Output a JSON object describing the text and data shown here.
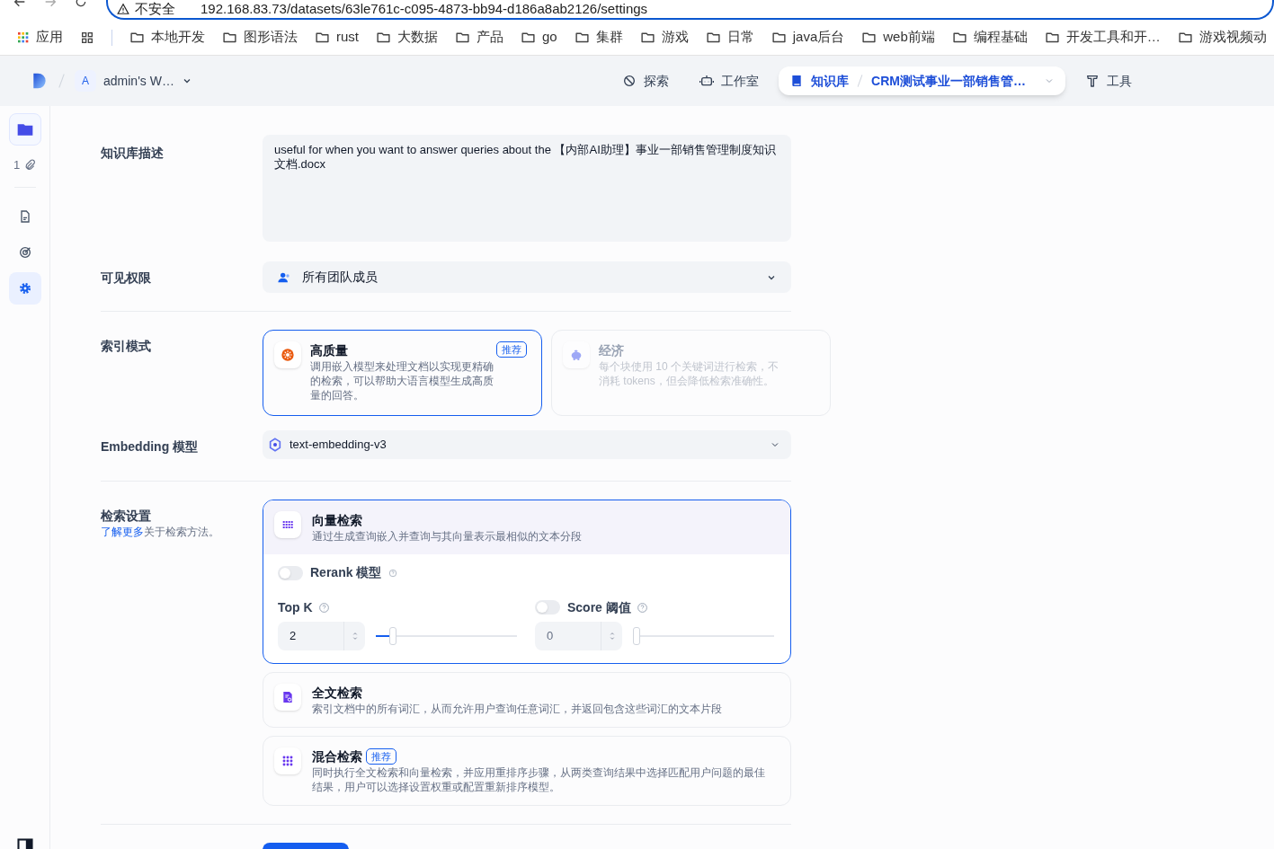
{
  "browser": {
    "address": {
      "security_label": "不安全",
      "url": "192.168.83.73/datasets/63le761c-c095-4873-bb94-d186a8ab2126/settings"
    },
    "bookmarks": [
      {
        "kind": "apps",
        "label": "应用"
      },
      {
        "kind": "grid"
      },
      {
        "kind": "folder",
        "label": "本地开发"
      },
      {
        "kind": "folder",
        "label": "图形语法"
      },
      {
        "kind": "folder",
        "label": "rust"
      },
      {
        "kind": "folder",
        "label": "大数据"
      },
      {
        "kind": "folder",
        "label": "产品"
      },
      {
        "kind": "folder",
        "label": "go"
      },
      {
        "kind": "folder",
        "label": "集群"
      },
      {
        "kind": "folder",
        "label": "游戏"
      },
      {
        "kind": "folder",
        "label": "日常"
      },
      {
        "kind": "folder",
        "label": "java后台"
      },
      {
        "kind": "folder",
        "label": "web前端"
      },
      {
        "kind": "folder",
        "label": "编程基础"
      },
      {
        "kind": "folder",
        "label": "开发工具和开…"
      },
      {
        "kind": "folder",
        "label": "游戏视频动"
      }
    ]
  },
  "header": {
    "workspace": {
      "initial": "A",
      "name": "admin's W…"
    },
    "nav": [
      {
        "kind": "explore",
        "label": "探索",
        "selected": false
      },
      {
        "kind": "studio",
        "label": "工作室",
        "selected": false
      },
      {
        "kind": "knowledge",
        "label": "知识库",
        "selected": true,
        "breadcrumb": "CRM测试事业一部销售管…"
      },
      {
        "kind": "tools",
        "label": "工具",
        "selected": false
      }
    ]
  },
  "sidebar": {
    "file_count": "1",
    "items": [
      {
        "kind": "documents",
        "selected": false
      },
      {
        "kind": "hit-testing",
        "selected": false
      },
      {
        "kind": "settings",
        "selected": true
      }
    ]
  },
  "form": {
    "description": {
      "label": "知识库描述",
      "value": "useful for when you want to answer queries about the 【内部AI助理】事业一部销售管理制度知识文档.docx"
    },
    "permission": {
      "label": "可见权限",
      "value": "所有团队成员"
    },
    "index_mode": {
      "label": "索引模式",
      "options": [
        {
          "kind": "high-quality",
          "title": "高质量",
          "badge": "推荐",
          "description": "调用嵌入模型来处理文档以实现更精确的检索，可以帮助大语言模型生成高质量的回答。",
          "selected": true,
          "disabled": false
        },
        {
          "kind": "economy",
          "title": "经济",
          "description": "每个块使用 10 个关键词进行检索，不消耗 tokens，但会降低检索准确性。",
          "selected": false,
          "disabled": true
        }
      ]
    },
    "embedding": {
      "label": "Embedding 模型",
      "value": "text-embedding-v3"
    },
    "retrieval": {
      "label": "检索设置",
      "link": "了解更多",
      "hint": "关于检索方法。",
      "methods": [
        {
          "kind": "vector",
          "title": "向量检索",
          "description": "通过生成查询嵌入并查询与其向量表示最相似的文本分段",
          "selected": true
        },
        {
          "kind": "full-text",
          "title": "全文检索",
          "description": "索引文档中的所有词汇，从而允许用户查询任意词汇，并返回包含这些词汇的文本片段",
          "selected": false
        },
        {
          "kind": "hybrid",
          "title": "混合检索",
          "badge": "推荐",
          "description": "同时执行全文检索和向量检索，并应用重排序步骤，从两类查询结果中选择匹配用户问题的最佳结果，用户可以选择设置权重或配置重新排序模型。",
          "selected": false
        }
      ],
      "rerank": {
        "label": "Rerank 模型",
        "on": false
      },
      "top_k": {
        "label": "Top K",
        "value": "2",
        "level": 0.12
      },
      "score_threshold": {
        "label": "Score 阈值",
        "on": false,
        "value": "0",
        "level": 0
      }
    }
  }
}
